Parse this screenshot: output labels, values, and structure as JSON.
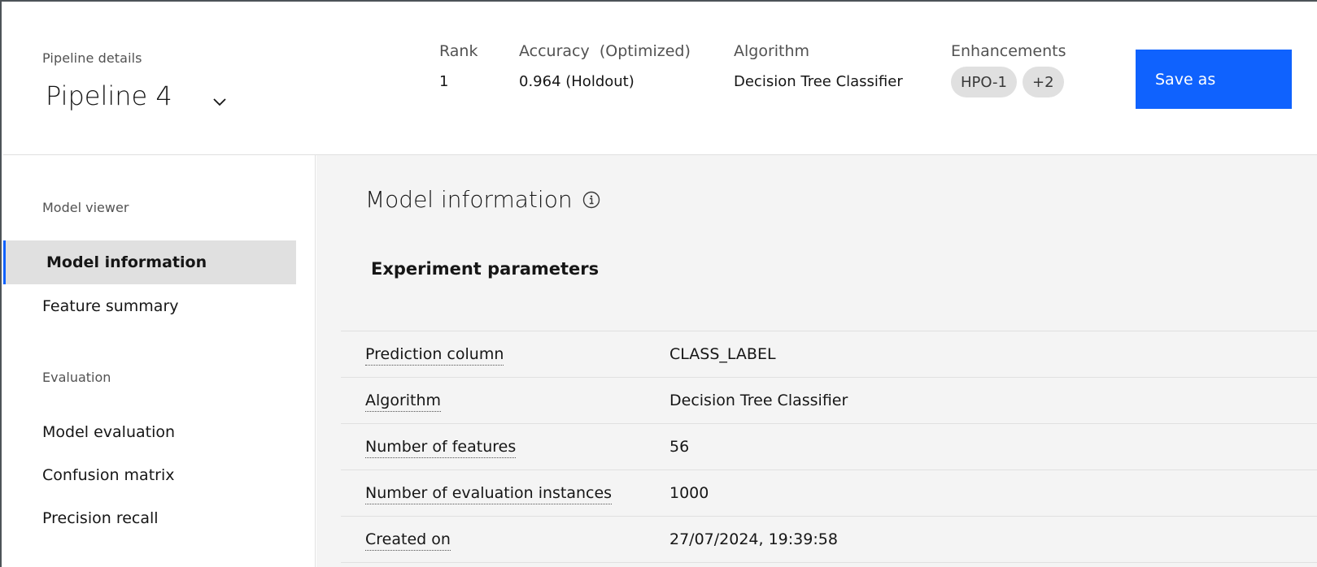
{
  "header": {
    "pipeline_details_label": "Pipeline details",
    "pipeline_name": "Pipeline 4",
    "rank_label": "Rank",
    "rank_value": "1",
    "accuracy_label": "Accuracy  (Optimized)",
    "accuracy_value": "0.964 (Holdout)",
    "algorithm_label": "Algorithm",
    "algorithm_value": "Decision Tree Classifier",
    "enhancements_label": "Enhancements",
    "enhancement_tags": [
      "HPO-1",
      "+2"
    ],
    "save_label": "Save as",
    "accent_color": "#0f62fe"
  },
  "sidebar": {
    "model_viewer_heading": "Model viewer",
    "model_viewer_items": [
      {
        "label": "Model information",
        "active": true
      },
      {
        "label": "Feature summary",
        "active": false
      }
    ],
    "evaluation_heading": "Evaluation",
    "evaluation_items": [
      {
        "label": "Model evaluation"
      },
      {
        "label": "Confusion matrix"
      },
      {
        "label": "Precision recall"
      }
    ]
  },
  "main": {
    "title": "Model information",
    "info_icon": "info-icon",
    "section_title": "Experiment parameters",
    "parameters": [
      {
        "key": "Prediction column",
        "value": "CLASS_LABEL"
      },
      {
        "key": "Algorithm",
        "value": "Decision Tree Classifier"
      },
      {
        "key": "Number of features",
        "value": "56"
      },
      {
        "key": "Number of evaluation instances",
        "value": "1000"
      },
      {
        "key": "Created on",
        "value": "27/07/2024, 19:39:58"
      }
    ]
  }
}
